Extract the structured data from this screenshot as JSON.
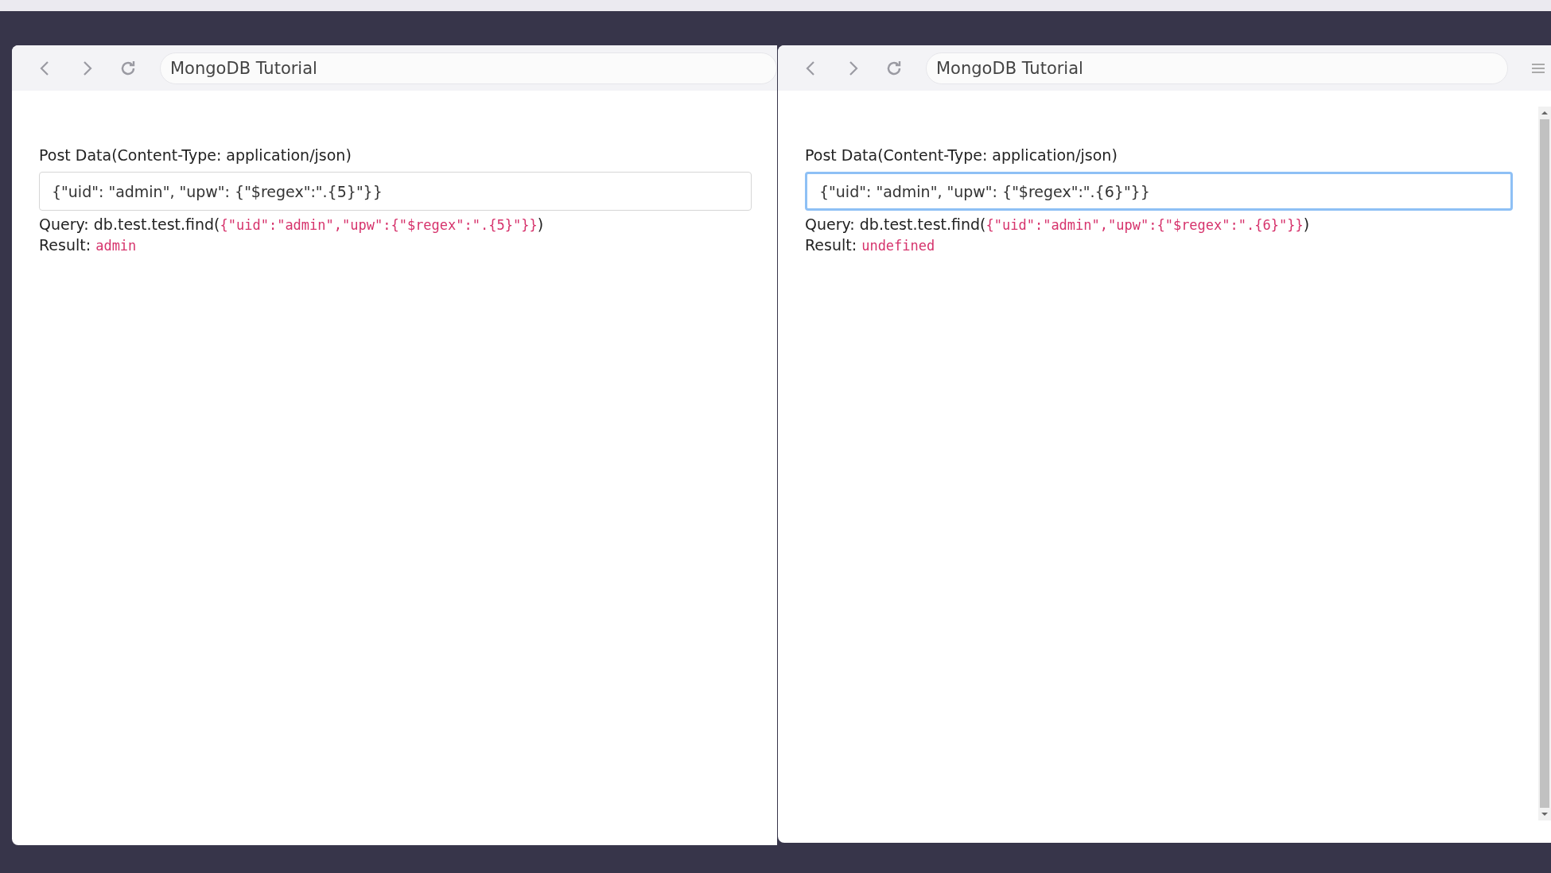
{
  "windows": [
    {
      "address": "MongoDB Tutorial",
      "label": "Post Data(Content-Type: application/json)",
      "input_value": "{\"uid\": \"admin\", \"upw\": {\"$regex\":\".{5}\"}}",
      "focused": false,
      "query_prefix": "Query: db.test.test.find(",
      "query_code": "{\"uid\":\"admin\",\"upw\":{\"$regex\":\".{5}\"}}",
      "query_suffix": ")",
      "result_label": "Result:",
      "result_value": "admin",
      "scrollbar": false
    },
    {
      "address": "MongoDB Tutorial",
      "label": "Post Data(Content-Type: application/json)",
      "input_value": "{\"uid\": \"admin\", \"upw\": {\"$regex\":\".{6}\"}}",
      "focused": true,
      "query_prefix": "Query: db.test.test.find(",
      "query_code": "{\"uid\":\"admin\",\"upw\":{\"$regex\":\".{6}\"}}",
      "query_suffix": ")",
      "result_label": "Result:",
      "result_value": "undefined",
      "scrollbar": true
    }
  ]
}
